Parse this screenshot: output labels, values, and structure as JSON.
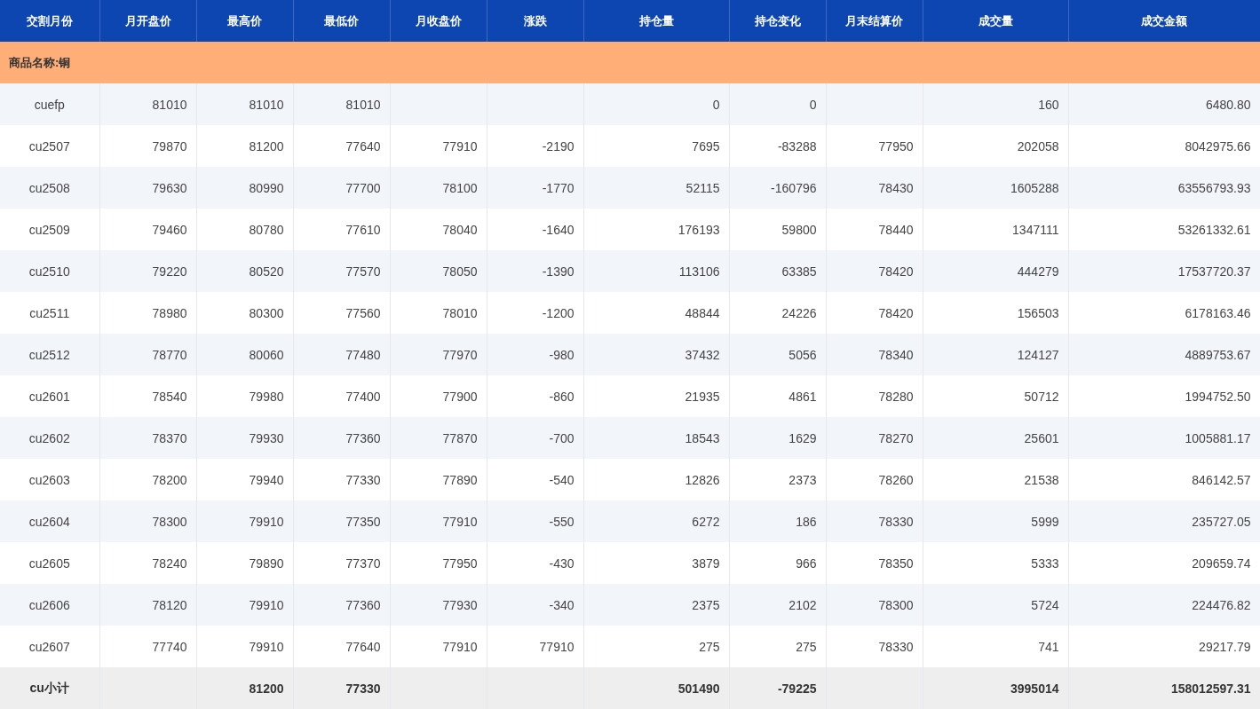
{
  "table": {
    "columns": [
      "交割月份",
      "月开盘价",
      "最高价",
      "最低价",
      "月收盘价",
      "涨跌",
      "持仓量",
      "持仓变化",
      "月末结算价",
      "成交量",
      "成交金额"
    ],
    "group_label": "商品名称:铜",
    "rows": [
      {
        "month": "cuefp",
        "open": "81010",
        "high": "81010",
        "low": "81010",
        "oi": "0",
        "oi_change": "0",
        "volume": "160",
        "turnover": "6480.80"
      },
      {
        "month": "cu2507",
        "open": "79870",
        "high": "81200",
        "low": "77640",
        "close": "77910",
        "change": "-2190",
        "oi": "7695",
        "oi_change": "-83288",
        "settle": "77950",
        "volume": "202058",
        "turnover": "8042975.66"
      },
      {
        "month": "cu2508",
        "open": "79630",
        "high": "80990",
        "low": "77700",
        "close": "78100",
        "change": "-1770",
        "oi": "52115",
        "oi_change": "-160796",
        "settle": "78430",
        "volume": "1605288",
        "turnover": "63556793.93"
      },
      {
        "month": "cu2509",
        "open": "79460",
        "high": "80780",
        "low": "77610",
        "close": "78040",
        "change": "-1640",
        "oi": "176193",
        "oi_change": "59800",
        "settle": "78440",
        "volume": "1347111",
        "turnover": "53261332.61"
      },
      {
        "month": "cu2510",
        "open": "79220",
        "high": "80520",
        "low": "77570",
        "close": "78050",
        "change": "-1390",
        "oi": "113106",
        "oi_change": "63385",
        "settle": "78420",
        "volume": "444279",
        "turnover": "17537720.37"
      },
      {
        "month": "cu2511",
        "open": "78980",
        "high": "80300",
        "low": "77560",
        "close": "78010",
        "change": "-1200",
        "oi": "48844",
        "oi_change": "24226",
        "settle": "78420",
        "volume": "156503",
        "turnover": "6178163.46"
      },
      {
        "month": "cu2512",
        "open": "78770",
        "high": "80060",
        "low": "77480",
        "close": "77970",
        "change": "-980",
        "oi": "37432",
        "oi_change": "5056",
        "settle": "78340",
        "volume": "124127",
        "turnover": "4889753.67"
      },
      {
        "month": "cu2601",
        "open": "78540",
        "high": "79980",
        "low": "77400",
        "close": "77900",
        "change": "-860",
        "oi": "21935",
        "oi_change": "4861",
        "settle": "78280",
        "volume": "50712",
        "turnover": "1994752.50"
      },
      {
        "month": "cu2602",
        "open": "78370",
        "high": "79930",
        "low": "77360",
        "close": "77870",
        "change": "-700",
        "oi": "18543",
        "oi_change": "1629",
        "settle": "78270",
        "volume": "25601",
        "turnover": "1005881.17"
      },
      {
        "month": "cu2603",
        "open": "78200",
        "high": "79940",
        "low": "77330",
        "close": "77890",
        "change": "-540",
        "oi": "12826",
        "oi_change": "2373",
        "settle": "78260",
        "volume": "21538",
        "turnover": "846142.57"
      },
      {
        "month": "cu2604",
        "open": "78300",
        "high": "79910",
        "low": "77350",
        "close": "77910",
        "change": "-550",
        "oi": "6272",
        "oi_change": "186",
        "settle": "78330",
        "volume": "5999",
        "turnover": "235727.05"
      },
      {
        "month": "cu2605",
        "open": "78240",
        "high": "79890",
        "low": "77370",
        "close": "77950",
        "change": "-430",
        "oi": "3879",
        "oi_change": "966",
        "settle": "78350",
        "volume": "5333",
        "turnover": "209659.74"
      },
      {
        "month": "cu2606",
        "open": "78120",
        "high": "79910",
        "low": "77360",
        "close": "77930",
        "change": "-340",
        "oi": "2375",
        "oi_change": "2102",
        "settle": "78300",
        "volume": "5724",
        "turnover": "224476.82"
      },
      {
        "month": "cu2607",
        "open": "77740",
        "high": "79910",
        "low": "77640",
        "close": "77910",
        "change": "77910",
        "oi": "275",
        "oi_change": "275",
        "settle": "78330",
        "volume": "741",
        "turnover": "29217.79"
      }
    ],
    "subtotal": {
      "month": "cu小计",
      "high": "81200",
      "low": "77330",
      "oi": "501490",
      "oi_change": "-79225",
      "volume": "3995014",
      "turnover": "158012597.31"
    }
  }
}
